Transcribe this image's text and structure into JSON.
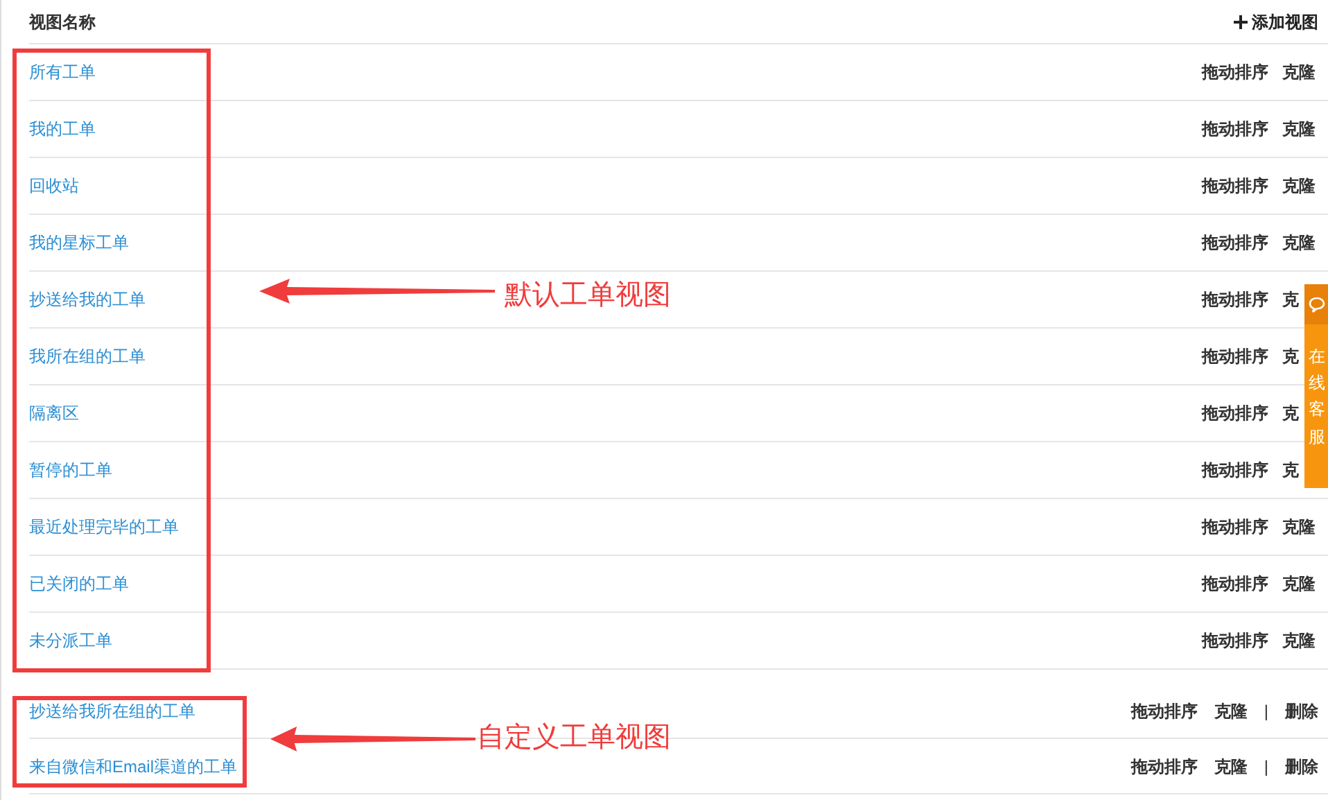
{
  "header": {
    "title": "视图名称",
    "add_button": "添加视图"
  },
  "groups": [
    {
      "kind": "default",
      "annotation": "默认工单视图",
      "rows": [
        {
          "name": "所有工单",
          "actions": [
            {
              "kind": "link",
              "label": "拖动排序"
            },
            {
              "kind": "link",
              "label": "克隆"
            }
          ]
        },
        {
          "name": "我的工单",
          "actions": [
            {
              "kind": "link",
              "label": "拖动排序"
            },
            {
              "kind": "link",
              "label": "克隆"
            }
          ]
        },
        {
          "name": "回收站",
          "actions": [
            {
              "kind": "link",
              "label": "拖动排序"
            },
            {
              "kind": "link",
              "label": "克隆"
            }
          ]
        },
        {
          "name": "我的星标工单",
          "actions": [
            {
              "kind": "link",
              "label": "拖动排序"
            },
            {
              "kind": "link",
              "label": "克隆"
            }
          ]
        },
        {
          "name": "抄送给我的工单",
          "actions": [
            {
              "kind": "link",
              "label": "拖动排序"
            },
            {
              "kind": "link",
              "label": "克"
            }
          ]
        },
        {
          "name": "我所在组的工单",
          "actions": [
            {
              "kind": "link",
              "label": "拖动排序"
            },
            {
              "kind": "link",
              "label": "克"
            }
          ]
        },
        {
          "name": "隔离区",
          "actions": [
            {
              "kind": "link",
              "label": "拖动排序"
            },
            {
              "kind": "link",
              "label": "克"
            }
          ]
        },
        {
          "name": "暂停的工单",
          "actions": [
            {
              "kind": "link",
              "label": "拖动排序"
            },
            {
              "kind": "link",
              "label": "克"
            }
          ]
        },
        {
          "name": "最近处理完毕的工单",
          "actions": [
            {
              "kind": "link",
              "label": "拖动排序"
            },
            {
              "kind": "link",
              "label": "克隆"
            }
          ]
        },
        {
          "name": "已关闭的工单",
          "actions": [
            {
              "kind": "link",
              "label": "拖动排序"
            },
            {
              "kind": "link",
              "label": "克隆"
            }
          ]
        },
        {
          "name": "未分派工单",
          "actions": [
            {
              "kind": "link",
              "label": "拖动排序"
            },
            {
              "kind": "link",
              "label": "克隆"
            }
          ]
        }
      ]
    },
    {
      "kind": "custom",
      "annotation": "自定义工单视图",
      "rows": [
        {
          "name": "抄送给我所在组的工单",
          "actions": [
            {
              "kind": "link",
              "label": "拖动排序"
            },
            {
              "kind": "link",
              "label": "克隆"
            },
            {
              "kind": "separator",
              "label": "|"
            },
            {
              "kind": "link",
              "label": "删除"
            }
          ]
        },
        {
          "name": "来自微信和Email渠道的工单",
          "actions": [
            {
              "kind": "link",
              "label": "拖动排序"
            },
            {
              "kind": "link",
              "label": "克隆"
            },
            {
              "kind": "separator",
              "label": "|"
            },
            {
              "kind": "link",
              "label": "删除"
            }
          ]
        }
      ]
    }
  ],
  "chat_widget": {
    "label": "在线客服"
  }
}
